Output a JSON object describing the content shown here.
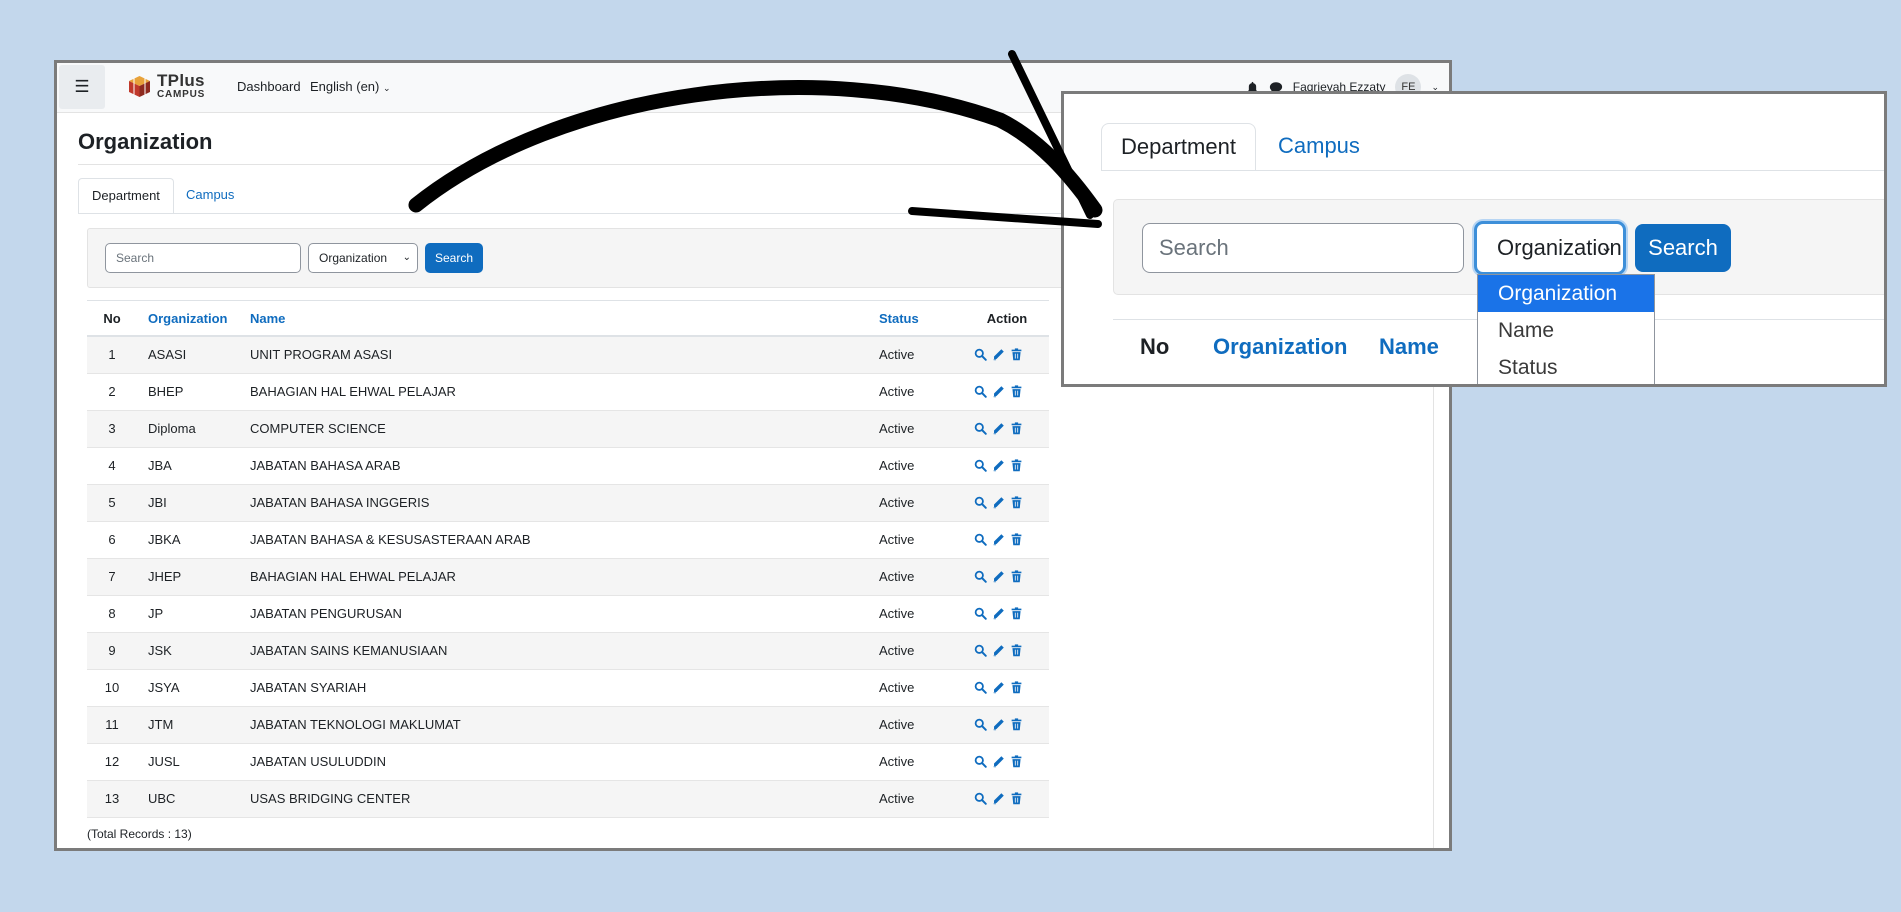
{
  "navbar": {
    "logo_line1": "TPlus",
    "logo_line2": "CAMPUS",
    "dashboard_label": "Dashboard",
    "language_label": "English (en)",
    "user_name": "Faqrieyah Ezzaty",
    "user_initials": "FE"
  },
  "page": {
    "title": "Organization",
    "tabs": [
      {
        "label": "Department",
        "active": true
      },
      {
        "label": "Campus",
        "active": false
      }
    ]
  },
  "search": {
    "placeholder": "Search",
    "filter_selected": "Organization",
    "filter_options": [
      "Organization",
      "Name",
      "Status"
    ],
    "button_label": "Search"
  },
  "table": {
    "headers": {
      "no": "No",
      "organization": "Organization",
      "name": "Name",
      "status": "Status",
      "action": "Action"
    },
    "rows": [
      {
        "no": "1",
        "organization": "ASASI",
        "name": "UNIT PROGRAM ASASI",
        "status": "Active"
      },
      {
        "no": "2",
        "organization": "BHEP",
        "name": "BAHAGIAN HAL EHWAL PELAJAR",
        "status": "Active"
      },
      {
        "no": "3",
        "organization": "Diploma",
        "name": "COMPUTER SCIENCE",
        "status": "Active"
      },
      {
        "no": "4",
        "organization": "JBA",
        "name": "JABATAN BAHASA ARAB",
        "status": "Active"
      },
      {
        "no": "5",
        "organization": "JBI",
        "name": "JABATAN BAHASA INGGERIS",
        "status": "Active"
      },
      {
        "no": "6",
        "organization": "JBKA",
        "name": "JABATAN BAHASA & KESUSASTERAAN ARAB",
        "status": "Active"
      },
      {
        "no": "7",
        "organization": "JHEP",
        "name": "BAHAGIAN HAL EHWAL PELAJAR",
        "status": "Active"
      },
      {
        "no": "8",
        "organization": "JP",
        "name": "JABATAN PENGURUSAN",
        "status": "Active"
      },
      {
        "no": "9",
        "organization": "JSK",
        "name": "JABATAN SAINS KEMANUSIAAN",
        "status": "Active"
      },
      {
        "no": "10",
        "organization": "JSYA",
        "name": "JABATAN SYARIAH",
        "status": "Active"
      },
      {
        "no": "11",
        "organization": "JTM",
        "name": "JABATAN TEKNOLOGI MAKLUMAT",
        "status": "Active"
      },
      {
        "no": "12",
        "organization": "JUSL",
        "name": "JABATAN USULUDDIN",
        "status": "Active"
      },
      {
        "no": "13",
        "organization": "UBC",
        "name": "USAS BRIDGING CENTER",
        "status": "Active"
      }
    ],
    "total_records": "(Total Records : 13)"
  },
  "icons": {
    "view": "magnifier-icon",
    "edit": "pencil-icon",
    "delete": "trash-icon",
    "menu": "hamburger-icon",
    "notifications": "bell-icon",
    "messages": "chat-icon"
  },
  "colors": {
    "accent": "#0f6cbf",
    "background": "#c3d7ec",
    "dropdown_highlight": "#1a73e8"
  }
}
